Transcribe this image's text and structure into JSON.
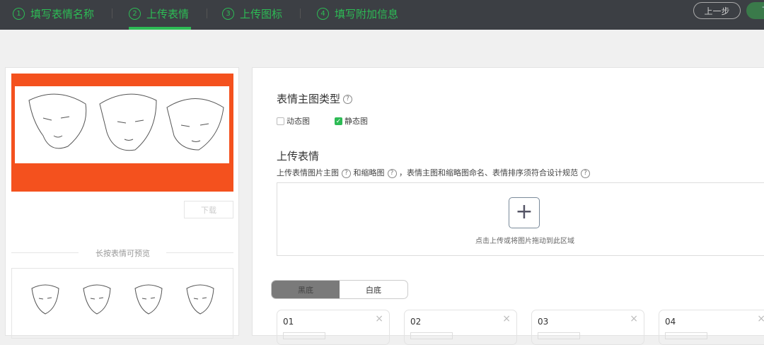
{
  "steps": [
    {
      "num": "1",
      "label": "填写表情名称"
    },
    {
      "num": "2",
      "label": "上传表情"
    },
    {
      "num": "3",
      "label": "上传图标"
    },
    {
      "num": "4",
      "label": "填写附加信息"
    }
  ],
  "buttons": {
    "prev": "上一步",
    "next": "下"
  },
  "left": {
    "download": "下载",
    "preview_hint": "长按表情可预览"
  },
  "main": {
    "type_title": "表情主图类型",
    "q": "?",
    "checkboxes": [
      {
        "label": "动态图",
        "checked": false
      },
      {
        "label": "静态图",
        "checked": true
      }
    ],
    "upload_title": "上传表情",
    "desc": [
      "上传表情图片主图",
      "和缩略图",
      "，表情主图和缩略图命名、表情排序须符合设计规范"
    ],
    "upload_plus": "+",
    "upload_hint": "点击上传或将图片拖动到此区域",
    "bg_toggle": [
      "黑底",
      "白底"
    ],
    "cards": [
      "01",
      "02",
      "03",
      "04"
    ],
    "close": "×"
  },
  "colors": {
    "accent": "#2dbb55",
    "banner": "#f4511e",
    "topbar": "#3c3f44"
  }
}
